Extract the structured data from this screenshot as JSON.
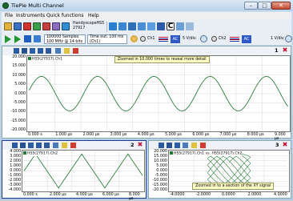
{
  "window": {
    "title": "TiePie Multi Channel"
  },
  "menu": {
    "items": [
      "File",
      "Instruments",
      "Quick functions",
      "Help"
    ]
  },
  "toolbar": {
    "instrument_line1": "HandyscopeHS5",
    "instrument_line2": "27917",
    "samples_line1": "100000 Samples",
    "samples_line2": "100 MHz @ 14 bits",
    "timeout_line1": "Time out: 100 ms",
    "timeout_line2": "(Ch1)",
    "ch1_label": "Ch1",
    "ch1_range": "5 V/div",
    "ch2_label": "Ch2",
    "ch2_range": "1 V/div",
    "ac_label": "AC",
    "c_label": "C"
  },
  "colors": {
    "trace": "#2a7d3a",
    "tooltip": "#ffffc8",
    "panel_accent": "#1f3a93"
  },
  "panel1": {
    "number": "1",
    "channel": "HS5(27917).Ch1",
    "tooltip": "Zoomed in 10.000 times to reveal more detail",
    "y_ticks": [
      "20.000",
      "15.000",
      "10.000",
      "5.000",
      "0.000",
      "-5.000",
      "-10.000",
      "-15.000",
      "-20.000"
    ],
    "x_ticks": [
      "0.000 s",
      "1.000 µs",
      "2.000 µs",
      "3.000 µs",
      "4.000 µs",
      "5.000 µs",
      "6.000 µs",
      "7.000 µs",
      "8.000 µs",
      "9.000 µs"
    ],
    "x_unit": "µs",
    "y_unit_bottom": "V"
  },
  "panel2": {
    "number": "2",
    "channel": "HS5(27917).Ch2",
    "y_ticks": [
      "4.000",
      "3.000",
      "2.000",
      "1.000",
      "0.000",
      "-1.000",
      "-2.000",
      "-3.000",
      "-4.000"
    ],
    "x_ticks": [
      "0.000 s",
      "2.000 µs",
      "4.000 µs",
      "6.000 µs",
      "8.000 µs"
    ]
  },
  "panel3": {
    "number": "3",
    "channel": "HS5(27917).Ch1 vs. HS5(27917).Ch2",
    "tooltip": "Zoomed in to a section of the XY signal",
    "y_ticks": [
      "20.000",
      "15.000",
      "10.000",
      "5.000",
      "0.000",
      "-5.000",
      "-10.000",
      "-15.000",
      "-20.000"
    ],
    "x_ticks": [
      "-4.0000",
      "-2.0000",
      "0.0000",
      "2.0000",
      "4.0000"
    ]
  }
}
